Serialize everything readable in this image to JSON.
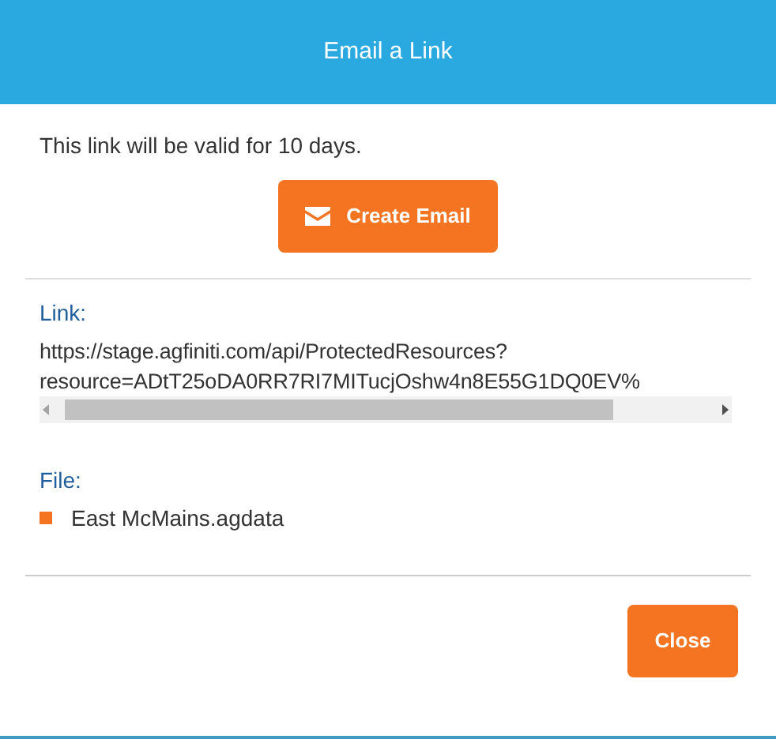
{
  "dialog": {
    "title": "Email a Link"
  },
  "message": "This link will be valid for 10 days.",
  "create_button": {
    "label": "Create Email"
  },
  "link": {
    "label": "Link:",
    "lines": [
      "https://stage.agfiniti.com/api/ProtectedResources?",
      "resource=ADtT25oDA0RR7RI7MITucjOshw4n8E55G1DQ0EV%"
    ]
  },
  "file": {
    "label": "File:",
    "items": [
      "East McMains.agdata"
    ]
  },
  "buttons": [
    {
      "label": "Close"
    }
  ]
}
